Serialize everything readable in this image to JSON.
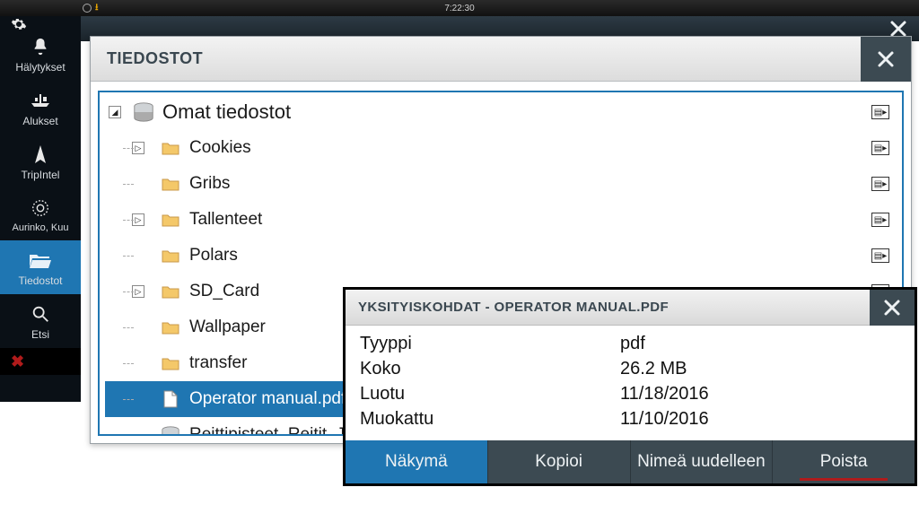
{
  "statusbar": {
    "time": "7:22:30"
  },
  "sidebar": {
    "items": [
      {
        "id": "alerts",
        "label": "Hälytykset"
      },
      {
        "id": "vessels",
        "label": "Alukset"
      },
      {
        "id": "tripintel",
        "label": "TripIntel"
      },
      {
        "id": "sunmoon",
        "label": "Aurinko, Kuu"
      },
      {
        "id": "files",
        "label": "Tiedostot"
      },
      {
        "id": "search",
        "label": "Etsi"
      }
    ]
  },
  "filewin": {
    "title": "TIEDOSTOT",
    "root_label": "Omat tiedostot",
    "children": [
      {
        "label": "Cookies",
        "expandable": true,
        "detail": true
      },
      {
        "label": "Gribs",
        "expandable": false,
        "detail": true
      },
      {
        "label": "Tallenteet",
        "expandable": true,
        "detail": true
      },
      {
        "label": "Polars",
        "expandable": false,
        "detail": true
      },
      {
        "label": "SD_Card",
        "expandable": true,
        "detail": true
      },
      {
        "label": "Wallpaper",
        "expandable": false,
        "detail": true
      },
      {
        "label": "transfer",
        "expandable": false,
        "detail": true
      },
      {
        "label": "Operator manual.pdf",
        "expandable": false,
        "detail": false,
        "file": true,
        "selected": true
      },
      {
        "label": "Reittipisteet, Reitit, Jäljet",
        "expandable": false,
        "detail": false,
        "group": true
      }
    ]
  },
  "details": {
    "title": "YKSITYISKOHDAT - OPERATOR MANUAL.PDF",
    "rows": [
      {
        "k": "Tyyppi",
        "v": "pdf"
      },
      {
        "k": "Koko",
        "v": "26.2 MB"
      },
      {
        "k": "Luotu",
        "v": "11/18/2016"
      },
      {
        "k": "Muokattu",
        "v": "11/10/2016"
      }
    ],
    "actions": {
      "view": "Näkymä",
      "copy": "Kopioi",
      "rename": "Nimeä uudelleen",
      "delete": "Poista"
    }
  }
}
